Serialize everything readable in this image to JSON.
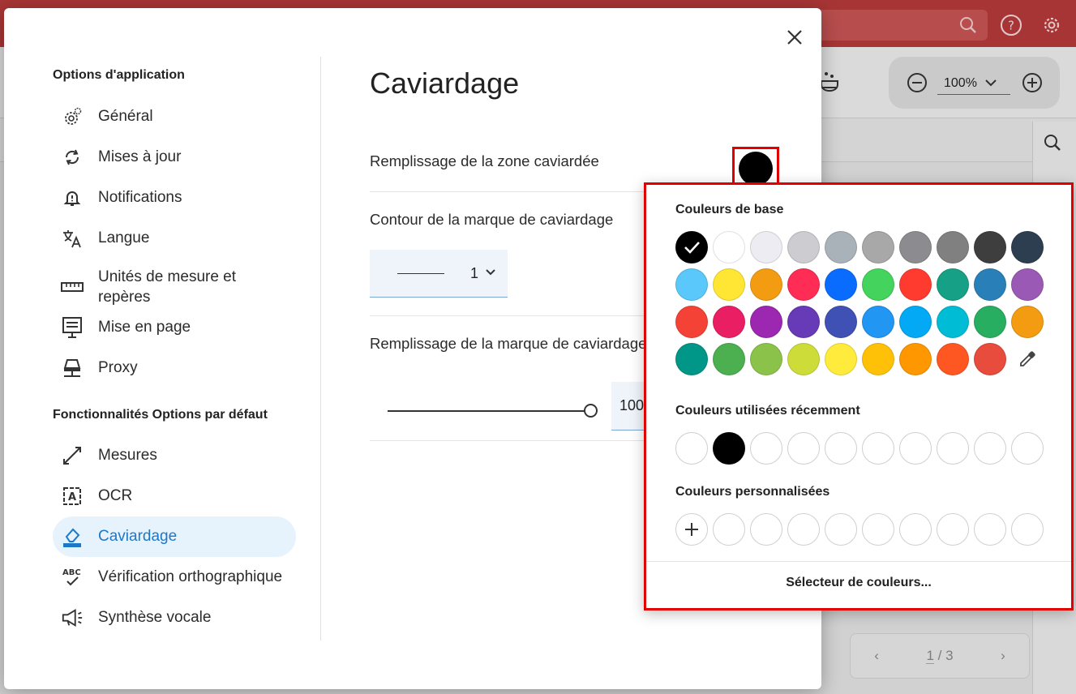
{
  "app": {
    "zoom_value": "100%",
    "page_current": "1",
    "page_total": "/ 3"
  },
  "dialog": {
    "sidebar": {
      "app_section_title": "Options d'application",
      "app_items": [
        {
          "label": "Général",
          "icon": "gear-icon"
        },
        {
          "label": "Mises à jour",
          "icon": "sync-icon"
        },
        {
          "label": "Notifications",
          "icon": "bell-icon"
        },
        {
          "label": "Langue",
          "icon": "translate-icon"
        },
        {
          "label": "Unités de mesure et repères",
          "icon": "ruler-icon"
        },
        {
          "label": "Mise en page",
          "icon": "layout-icon"
        },
        {
          "label": "Proxy",
          "icon": "proxy-icon"
        }
      ],
      "features_section_title": "Fonctionnalités Options par défaut",
      "feature_items": [
        {
          "label": "Mesures",
          "icon": "measure-icon"
        },
        {
          "label": "OCR",
          "icon": "ocr-icon"
        },
        {
          "label": "Caviardage",
          "icon": "eraser-icon",
          "active": true
        },
        {
          "label": "Vérification orthographique",
          "icon": "spellcheck-icon"
        },
        {
          "label": "Synthèse vocale",
          "icon": "megaphone-icon"
        }
      ]
    },
    "main": {
      "title": "Caviardage",
      "fill_label": "Remplissage de la zone caviardée",
      "fill_color": "#000000",
      "outline_label": "Contour de la marque de caviardage",
      "outline_width": "1",
      "mark_fill_label": "Remplissage de la marque de caviardage",
      "opacity_value": "100",
      "opacity_level": 1.0
    }
  },
  "color_popup": {
    "basic_title": "Couleurs de base",
    "basic_colors": [
      "#000000",
      "#ffffff",
      "#ececf2",
      "#cdcdd1",
      "#a9b1b9",
      "#a8a8a8",
      "#8c8c90",
      "#808080",
      "#3e3e3e",
      "#2c3e50",
      "#5ac8fa",
      "#ffe534",
      "#f39c12",
      "#ff2d55",
      "#0a6cff",
      "#44d35c",
      "#ff3b30",
      "#16a085",
      "#2980b9",
      "#9b59b6",
      "#f44336",
      "#e91e63",
      "#9c27b0",
      "#673ab7",
      "#3f51b5",
      "#2196f3",
      "#03a9f4",
      "#00bcd4",
      "#27ae60",
      "#f39c12",
      "#009688",
      "#4caf50",
      "#8bc34a",
      "#cddc39",
      "#ffeb3b",
      "#ffc107",
      "#ff9800",
      "#ff5722",
      "#e74c3c"
    ],
    "selected_color": "#000000",
    "eyedropper_icon": "eyedropper-icon",
    "recent_title": "Couleurs utilisées récemment",
    "recent_colors": [
      "#ffffff",
      "#000000",
      "",
      "",
      "",
      "",
      "",
      "",
      "",
      ""
    ],
    "custom_title": "Couleurs personnalisées",
    "custom_slots": 9,
    "picker_label": "Sélecteur de couleurs..."
  }
}
